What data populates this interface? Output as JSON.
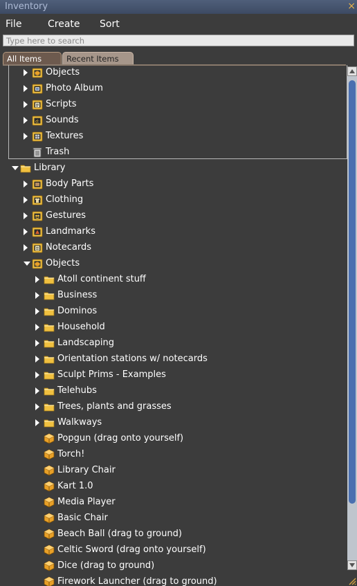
{
  "window": {
    "title": "Inventory",
    "close_symbol": "×"
  },
  "menu": [
    {
      "label": "File"
    },
    {
      "label": "Create"
    },
    {
      "label": "Sort"
    }
  ],
  "search": {
    "placeholder": "Type here to search",
    "value": ""
  },
  "tabs": [
    {
      "label": "All Items",
      "active": true
    },
    {
      "label": "Recent Items",
      "active": false
    }
  ],
  "colors": {
    "background": "#3c3c3c",
    "folder": "#f0c040",
    "object_box": "#e8a028",
    "scroll_thumb": "#4a6fb0",
    "active_tab": "#6d5a4e"
  },
  "tree": [
    {
      "label": "Objects",
      "depth": 1,
      "arrow": "right",
      "icon": "objects-folder-icon"
    },
    {
      "label": "Photo Album",
      "depth": 1,
      "arrow": "right",
      "icon": "photo-album-folder-icon"
    },
    {
      "label": "Scripts",
      "depth": 1,
      "arrow": "right",
      "icon": "scripts-folder-icon"
    },
    {
      "label": "Sounds",
      "depth": 1,
      "arrow": "right",
      "icon": "sounds-folder-icon"
    },
    {
      "label": "Textures",
      "depth": 1,
      "arrow": "right",
      "icon": "textures-folder-icon"
    },
    {
      "label": "Trash",
      "depth": 1,
      "arrow": "none",
      "icon": "trash-icon"
    },
    {
      "label": "Library",
      "depth": 0,
      "arrow": "down",
      "icon": "folder-icon"
    },
    {
      "label": "Body Parts",
      "depth": 1,
      "arrow": "right",
      "icon": "body-parts-folder-icon"
    },
    {
      "label": "Clothing",
      "depth": 1,
      "arrow": "right",
      "icon": "clothing-folder-icon"
    },
    {
      "label": "Gestures",
      "depth": 1,
      "arrow": "right",
      "icon": "gestures-folder-icon"
    },
    {
      "label": "Landmarks",
      "depth": 1,
      "arrow": "right",
      "icon": "landmarks-folder-icon"
    },
    {
      "label": "Notecards",
      "depth": 1,
      "arrow": "right",
      "icon": "notecards-folder-icon"
    },
    {
      "label": "Objects",
      "depth": 1,
      "arrow": "down",
      "icon": "objects-folder-icon"
    },
    {
      "label": "Atoll continent stuff",
      "depth": 2,
      "arrow": "right",
      "icon": "folder-icon"
    },
    {
      "label": "Business",
      "depth": 2,
      "arrow": "right",
      "icon": "folder-icon"
    },
    {
      "label": "Dominos",
      "depth": 2,
      "arrow": "right",
      "icon": "folder-icon"
    },
    {
      "label": "Household",
      "depth": 2,
      "arrow": "right",
      "icon": "folder-icon"
    },
    {
      "label": "Landscaping",
      "depth": 2,
      "arrow": "right",
      "icon": "folder-icon"
    },
    {
      "label": "Orientation stations w/ notecards",
      "depth": 2,
      "arrow": "right",
      "icon": "folder-icon"
    },
    {
      "label": "Sculpt Prims - Examples",
      "depth": 2,
      "arrow": "right",
      "icon": "folder-icon"
    },
    {
      "label": "Telehubs",
      "depth": 2,
      "arrow": "right",
      "icon": "folder-icon"
    },
    {
      "label": "Trees, plants and grasses",
      "depth": 2,
      "arrow": "right",
      "icon": "folder-icon"
    },
    {
      "label": "Walkways",
      "depth": 2,
      "arrow": "right",
      "icon": "folder-icon"
    },
    {
      "label": "Popgun (drag onto yourself)",
      "depth": 2,
      "arrow": "none",
      "icon": "object-box-icon"
    },
    {
      "label": "Torch!",
      "depth": 2,
      "arrow": "none",
      "icon": "object-box-icon"
    },
    {
      "label": "Library Chair",
      "depth": 2,
      "arrow": "none",
      "icon": "object-box-icon"
    },
    {
      "label": "Kart 1.0",
      "depth": 2,
      "arrow": "none",
      "icon": "object-box-icon"
    },
    {
      "label": "Media Player",
      "depth": 2,
      "arrow": "none",
      "icon": "object-box-icon"
    },
    {
      "label": "Basic Chair",
      "depth": 2,
      "arrow": "none",
      "icon": "object-box-icon"
    },
    {
      "label": "Beach Ball (drag to ground)",
      "depth": 2,
      "arrow": "none",
      "icon": "object-box-icon"
    },
    {
      "label": "Celtic Sword (drag onto yourself)",
      "depth": 2,
      "arrow": "none",
      "icon": "object-box-icon"
    },
    {
      "label": "Dice (drag to ground)",
      "depth": 2,
      "arrow": "none",
      "icon": "object-box-icon"
    },
    {
      "label": "Firework Launcher (drag to ground)",
      "depth": 2,
      "arrow": "none",
      "icon": "object-box-icon"
    }
  ]
}
